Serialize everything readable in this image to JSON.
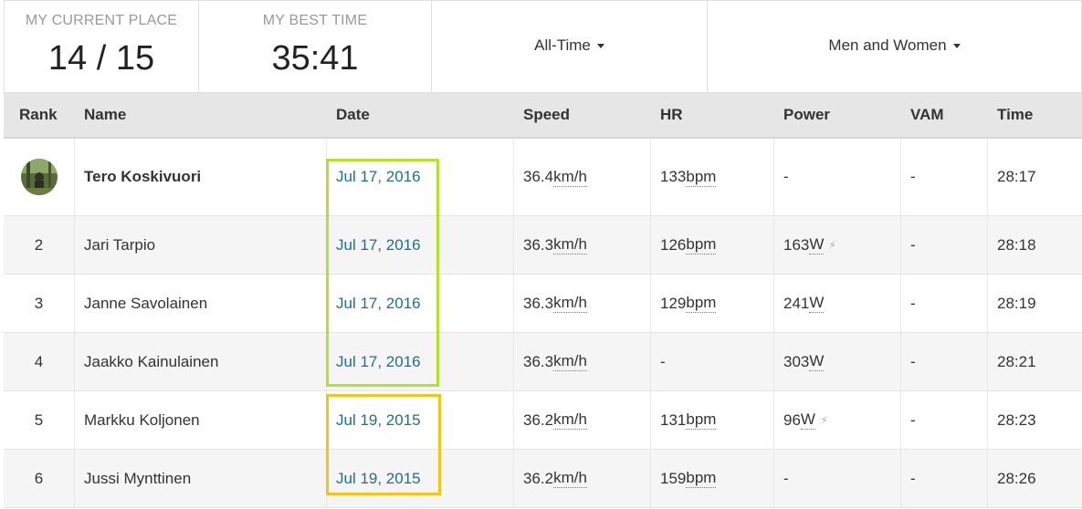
{
  "summary": {
    "current_place_label": "MY CURRENT PLACE",
    "current_place_value": "14 / 15",
    "best_time_label": "MY BEST TIME",
    "best_time_value": "35:41",
    "period_filter": "All-Time",
    "gender_filter": "Men and Women"
  },
  "columns": {
    "rank": "Rank",
    "name": "Name",
    "date": "Date",
    "speed": "Speed",
    "hr": "HR",
    "power": "Power",
    "vam": "VAM",
    "time": "Time"
  },
  "rows": [
    {
      "rank": "",
      "name": "Tero Koskivuori",
      "date": "Jul 17, 2016",
      "speed": "36.4",
      "speed_unit": "km/h",
      "hr": "133",
      "hr_unit": "bpm",
      "power": "-",
      "power_unit": "",
      "vam": "-",
      "time": "28:17"
    },
    {
      "rank": "2",
      "name": "Jari Tarpio",
      "date": "Jul 17, 2016",
      "speed": "36.3",
      "speed_unit": "km/h",
      "hr": "126",
      "hr_unit": "bpm",
      "power": "163",
      "power_unit": "W",
      "vam": "-",
      "time": "28:18"
    },
    {
      "rank": "3",
      "name": "Janne Savolainen",
      "date": "Jul 17, 2016",
      "speed": "36.3",
      "speed_unit": "km/h",
      "hr": "129",
      "hr_unit": "bpm",
      "power": "241",
      "power_unit": "W",
      "vam": "-",
      "time": "28:19"
    },
    {
      "rank": "4",
      "name": "Jaakko Kainulainen",
      "date": "Jul 17, 2016",
      "speed": "36.3",
      "speed_unit": "km/h",
      "hr": "-",
      "hr_unit": "",
      "power": "303",
      "power_unit": "W",
      "vam": "-",
      "time": "28:21"
    },
    {
      "rank": "5",
      "name": "Markku Koljonen",
      "date": "Jul 19, 2015",
      "speed": "36.2",
      "speed_unit": "km/h",
      "hr": "131",
      "hr_unit": "bpm",
      "power": "96",
      "power_unit": "W",
      "vam": "-",
      "time": "28:23"
    },
    {
      "rank": "6",
      "name": "Jussi Mynttinen",
      "date": "Jul 19, 2015",
      "speed": "36.2",
      "speed_unit": "km/h",
      "hr": "159",
      "hr_unit": "bpm",
      "power": "-",
      "power_unit": "",
      "vam": "-",
      "time": "28:26"
    }
  ],
  "colors": {
    "link": "#1f6d98",
    "highlight_green": "#b5e02f",
    "highlight_yellow": "#f1c51b"
  }
}
